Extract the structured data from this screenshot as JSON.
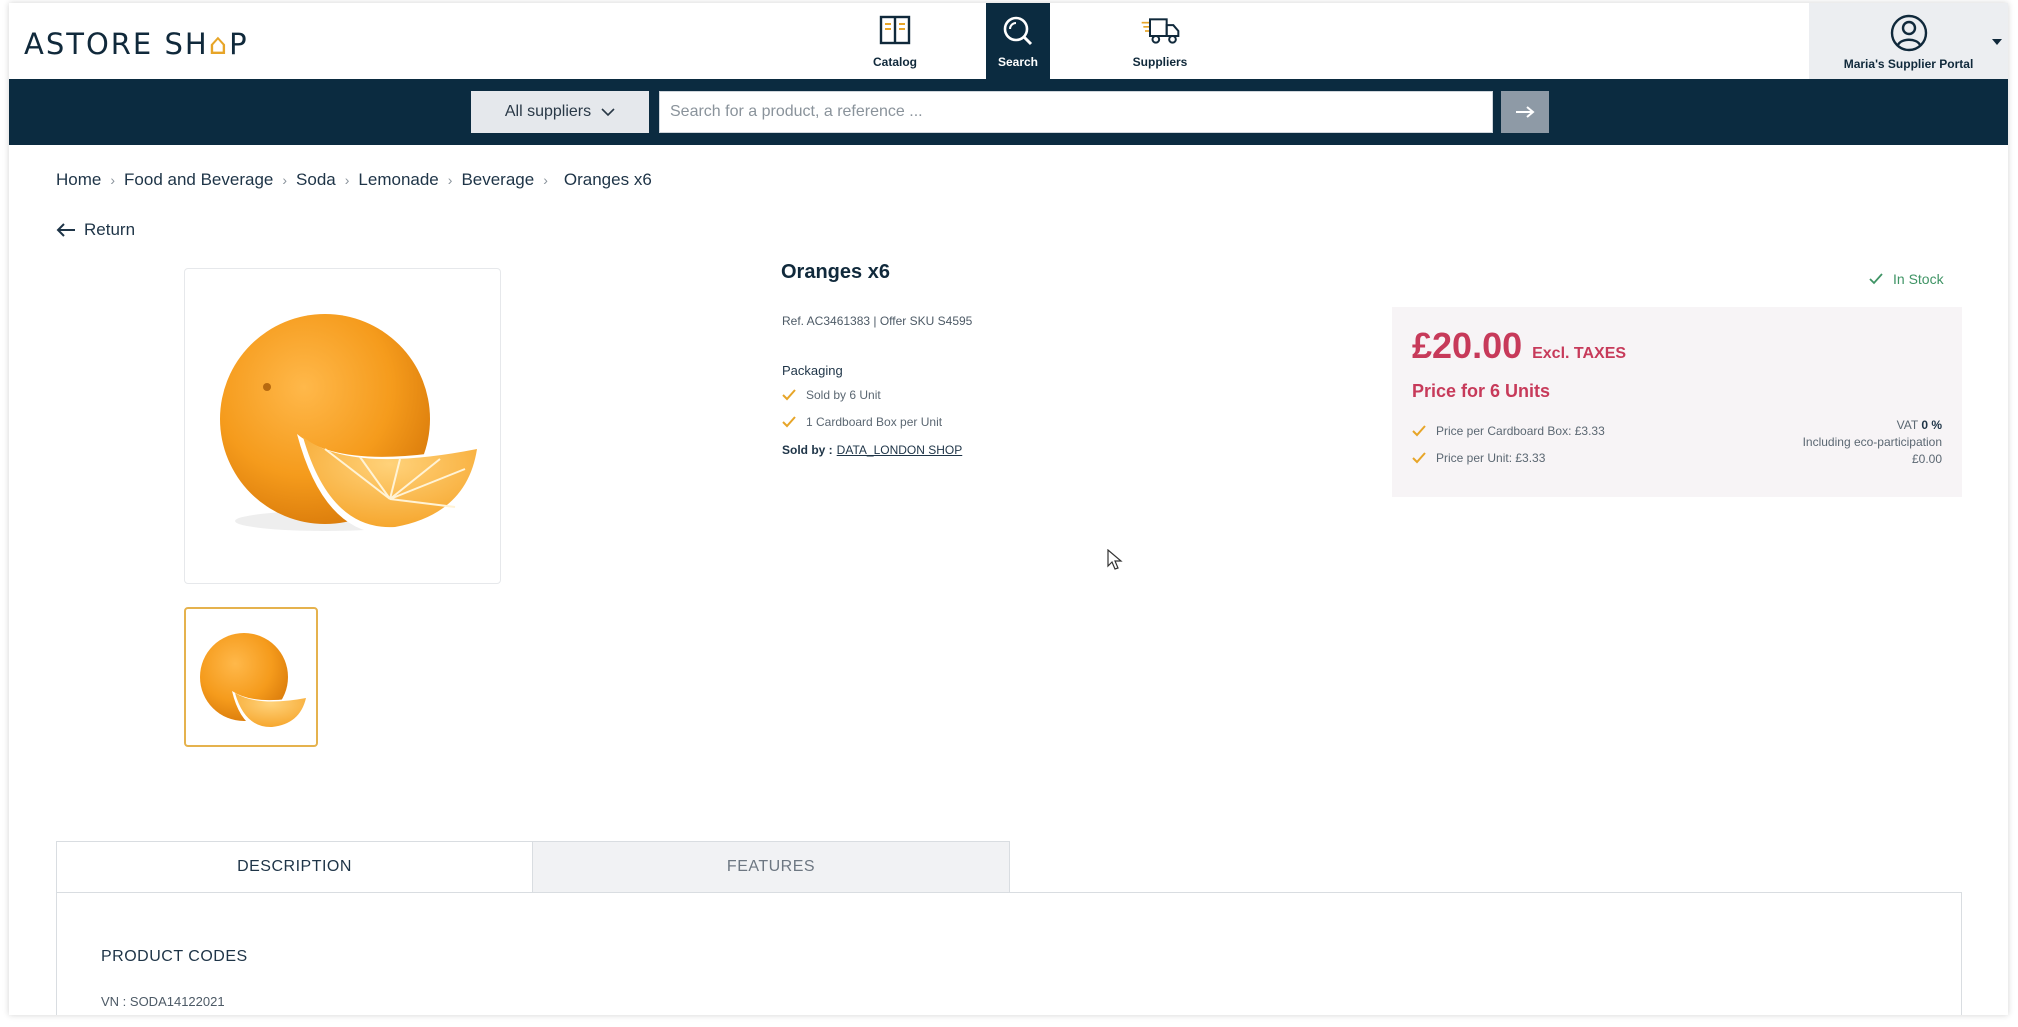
{
  "brand": {
    "prefix": "ASTORE SH",
    "house_glyph": "⌂",
    "suffix": "P"
  },
  "nav": {
    "catalog": {
      "label": "Catalog",
      "icon": "book-icon"
    },
    "search": {
      "label": "Search",
      "icon": "search-icon",
      "active": true
    },
    "suppliers": {
      "label": "Suppliers",
      "icon": "truck-icon"
    }
  },
  "portal": {
    "label": "Maria's Supplier Portal",
    "icon": "user-circle-icon"
  },
  "search": {
    "supplier_filter": "All suppliers",
    "placeholder": "Search for a product, a reference ...",
    "value": "",
    "go": "→"
  },
  "breadcrumb": {
    "items": [
      "Home",
      "Food and Beverage",
      "Soda",
      "Lemonade",
      "Beverage"
    ],
    "separator": "›",
    "current": "Oranges x6"
  },
  "return_label": "Return",
  "product": {
    "title": "Oranges x6",
    "reference": "Ref. AC3461383 | Offer SKU S4595",
    "packaging_title": "Packaging",
    "packaging": [
      "Sold by 6 Unit",
      "1 Cardboard Box per Unit"
    ],
    "sold_by_label": "Sold by :",
    "seller": "DATA_LONDON SHOP",
    "stock": "In Stock"
  },
  "price": {
    "amount": "£20.00",
    "excl": "Excl. TAXES",
    "units": "Price for 6 Units",
    "details": [
      "Price per Cardboard Box: £3.33",
      "Price per Unit: £3.33"
    ],
    "vat_label": "VAT",
    "vat_value": "0 %",
    "eco_label": "Including eco-participation",
    "eco_value": "£0.00"
  },
  "tabs": [
    {
      "label": "DESCRIPTION",
      "active": true
    },
    {
      "label": "FEATURES",
      "active": false
    }
  ],
  "description": {
    "section_title": "PRODUCT CODES",
    "code_line": "VN : SODA14122021"
  },
  "colors": {
    "navy": "#0b2b40",
    "accent_gold": "#e7a528",
    "price_red": "#c73a5a",
    "stock_green": "#3f9465"
  }
}
